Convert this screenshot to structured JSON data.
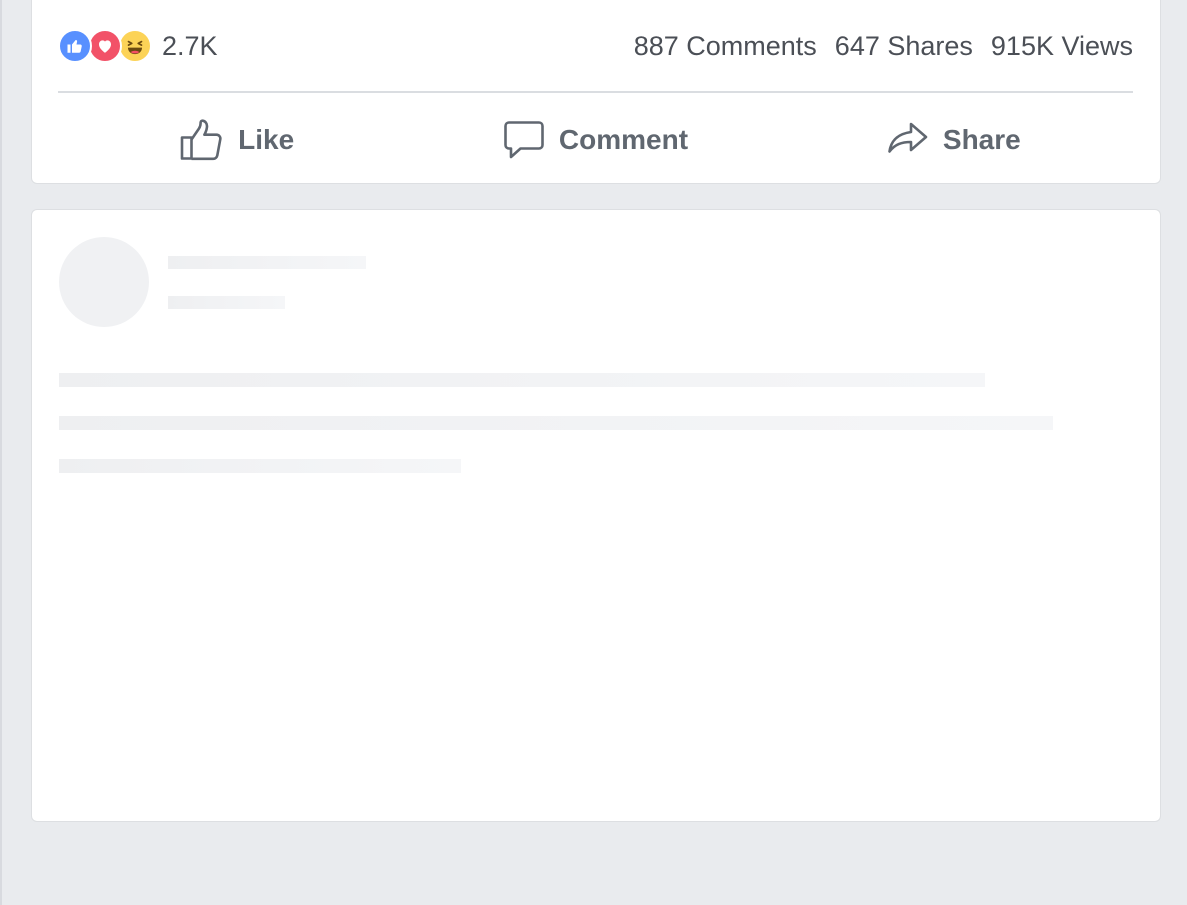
{
  "post": {
    "reactions": {
      "icons": [
        "like-reaction-icon",
        "love-reaction-icon",
        "haha-reaction-icon"
      ],
      "count": "2.7K"
    },
    "comments": "887 Comments",
    "shares": "647 Shares",
    "views": "915K Views",
    "actions": {
      "like": "Like",
      "comment": "Comment",
      "share": "Share"
    }
  },
  "colors": {
    "page_background": "#e9ebee",
    "card_background": "#ffffff",
    "text_secondary": "#606770",
    "like_blue": "#5890ff",
    "love_red": "#f25268",
    "haha_yellow": "#fcd357",
    "skeleton": "#eeeff1"
  }
}
